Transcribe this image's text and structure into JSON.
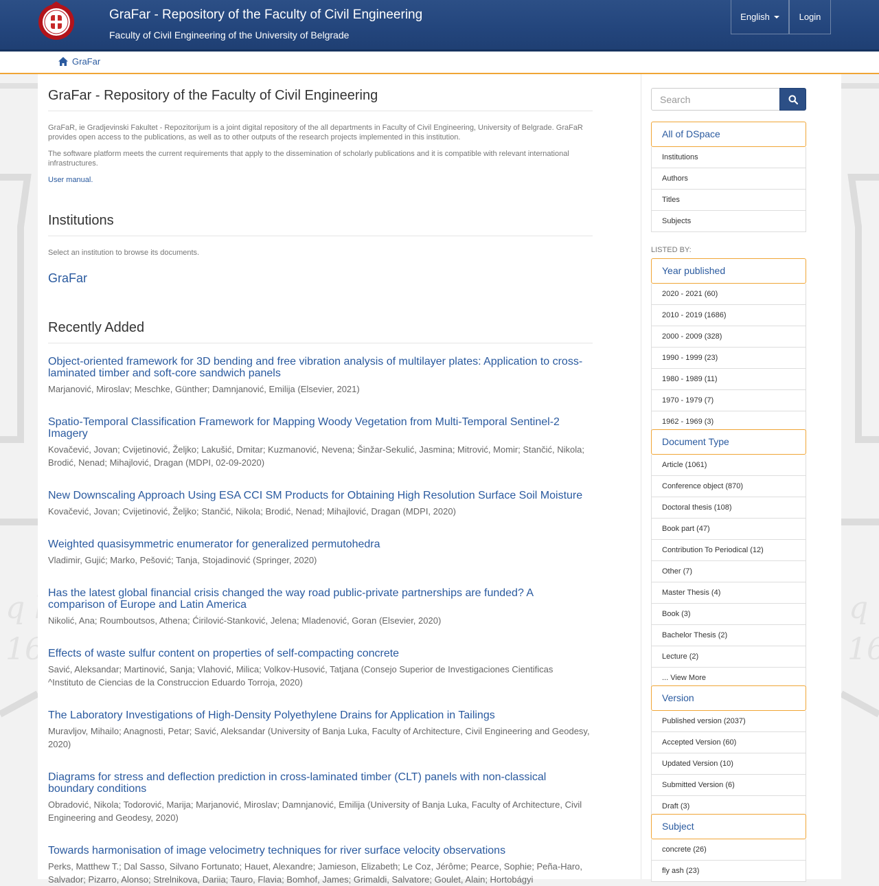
{
  "header": {
    "title": "GraFar - Repository of the Faculty of Civil Engineering",
    "subtitle": "Faculty of Civil Engineering of the University of Belgrade",
    "language_label": "English",
    "login_label": "Login"
  },
  "breadcrumb": {
    "home_label": "GraFar"
  },
  "main": {
    "page_title": "GraFar - Repository of the Faculty of Civil Engineering",
    "intro_p1": "GraFaR, ie Gradjevinski Fakultet - Repozitorijum is a joint digital repository of the all departments in Faculty of Civil Engineering, University of Belgrade. GraFaR provides open access to the publications, as well as to other outputs of the research projects implemented in this institution.",
    "intro_p2": "The software platform meets the current requirements that apply to the dissemination of scholarly publications and it is compatible with relevant international infrastructures.",
    "manual_link": "User manual.",
    "institutions_heading": "Institutions",
    "institutions_hint": "Select an institution to browse its documents.",
    "institution_link": "GraFar",
    "recent_heading": "Recently Added",
    "items": [
      {
        "title": "Object-oriented framework for 3D bending and free vibration analysis of multilayer plates: Application to cross-laminated timber and soft-core sandwich panels",
        "meta": "Marjanović, Miroslav; Meschke, Günther; Damnjanović, Emilija (Elsevier, 2021)"
      },
      {
        "title": "Spatio-Temporal Classification Framework for Mapping Woody Vegetation from Multi-Temporal Sentinel-2 Imagery",
        "meta": "Kovačević, Jovan; Cvijetinović, Željko; Lakušić, Dmitar; Kuzmanović, Nevena; Šinžar-Sekulić, Jasmina; Mitrović, Momir; Stančić, Nikola; Brodić, Nenad; Mihajlović, Dragan (MDPI, 02-09-2020)"
      },
      {
        "title": "New Downscaling Approach Using ESA CCI SM Products for Obtaining High Resolution Surface Soil Moisture",
        "meta": "Kovačević, Jovan; Cvijetinović, Željko; Stančić, Nikola; Brodić, Nenad; Mihajlović, Dragan (MDPI, 2020)"
      },
      {
        "title": "Weighted quasisymmetric enumerator for generalized permutohedra",
        "meta": "Vladimir, Gujić; Marko, Pešović; Tanja, Stojadinović (Springer, 2020)"
      },
      {
        "title": "Has the latest global financial crisis changed the way road public-private partnerships are funded? A comparison of Europe and Latin America",
        "meta": "Nikolić, Ana; Roumboutsos, Athena; Ćirilović-Stanković, Jelena; Mladenović, Goran (Elsevier, 2020)"
      },
      {
        "title": "Effects of waste sulfur content on properties of self-compacting concrete",
        "meta": "Savić, Aleksandar; Martinović, Sanja; Vlahović, Milica; Volkov-Husović, Tatjana (Consejo Superior de Investigaciones Cientificas ^Instituto de Ciencias de la Construccion Eduardo Torroja, 2020)"
      },
      {
        "title": "The Laboratory Investigations of High-Density Polyethylene Drains for Application in Tailings",
        "meta": "Muravljov, Mihailo; Anagnosti, Petar; Savić, Aleksandar (University of Banja Luka, Faculty of Architecture, Civil Engineering and Geodesy, 2020)"
      },
      {
        "title": "Diagrams for stress and deflection prediction in cross-laminated timber (CLT) panels with non-classical boundary conditions",
        "meta": "Obradović, Nikola; Todorović, Marija; Marjanović, Miroslav; Damnjanović, Emilija (University of Banja Luka, Faculty of Architecture, Civil Engineering and Geodesy, 2020)"
      },
      {
        "title": "Towards harmonisation of image velocimetry techniques for river surface velocity observations",
        "meta": "Perks, Matthew T.; Dal Sasso, Silvano Fortunato; Hauet, Alexandre; Jamieson, Elizabeth; Le Coz, Jérôme; Pearce, Sophie; Peña-Haro, Salvador; Pizarro, Alonso; Strelnikova, Dariia; Tauro, Flavia; Bomhof, James; Grimaldi, Salvatore; Goulet, Alain; Hortobágyi"
      }
    ]
  },
  "sidebar": {
    "search_placeholder": "Search",
    "all_heading": "All of DSpace",
    "browse": [
      "Institutions",
      "Authors",
      "Titles",
      "Subjects"
    ],
    "listed_by": "LISTED BY:",
    "year_heading": "Year published",
    "years": [
      "2020 - 2021 (60)",
      "2010 - 2019 (1686)",
      "2000 - 2009 (328)",
      "1990 - 1999 (23)",
      "1980 - 1989 (11)",
      "1970 - 1979 (7)",
      "1962 - 1969 (3)"
    ],
    "doctype_heading": "Document Type",
    "doctypes": [
      "Article (1061)",
      "Conference object (870)",
      "Doctoral thesis (108)",
      "Book part (47)",
      "Contribution To Periodical (12)",
      "Other (7)",
      "Master Thesis (4)",
      "Book (3)",
      "Bachelor Thesis (2)",
      "Lecture (2)",
      "... View More"
    ],
    "version_heading": "Version",
    "versions": [
      "Published version (2037)",
      "Accepted Version (60)",
      "Updated Version (10)",
      "Submitted Version (6)",
      "Draft (3)"
    ],
    "subject_heading": "Subject",
    "subjects": [
      "concrete (26)",
      "fly ash (23)"
    ]
  },
  "colors": {
    "header": "#23457c",
    "accent": "#f0a535",
    "link": "#2a5a9f"
  },
  "icons": [
    "home-icon",
    "search-icon",
    "caret-down-icon",
    "university-seal-logo"
  ]
}
